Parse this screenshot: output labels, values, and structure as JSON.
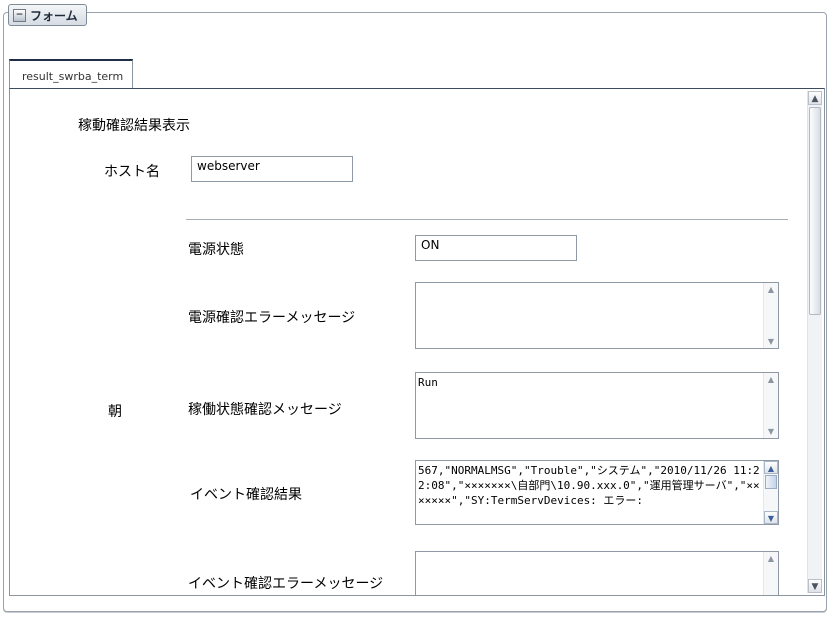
{
  "form": {
    "title": "フォーム",
    "tab_label": "result_swrba_term"
  },
  "section_title": "稼動確認結果表示",
  "host": {
    "label": "ホスト名",
    "value": "webserver"
  },
  "row_group_label": "朝",
  "fields": {
    "power_status": {
      "label": "電源状態",
      "value": "ON"
    },
    "power_error": {
      "label": "電源確認エラーメッセージ",
      "value": ""
    },
    "operation_status": {
      "label": "稼働状態確認メッセージ",
      "value": "Run"
    },
    "event_result": {
      "label": "イベント確認結果",
      "value": "567,\"NORMALMSG\",\"Trouble\",\"システム\",\"2010/11/26 11:22:08\",\"×××××××\\自部門\\10.90.xxx.0\",\"運用管理サーバ\",\"×××××××\",\"SY:TermServDevices: エラー:"
    },
    "event_error": {
      "label": "イベント確認エラーメッセージ",
      "value": ""
    }
  }
}
